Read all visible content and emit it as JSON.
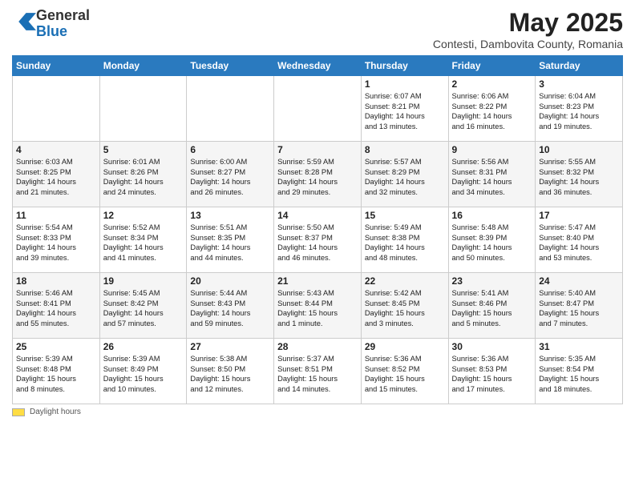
{
  "header": {
    "logo_line1": "General",
    "logo_line2": "Blue",
    "title": "May 2025",
    "subtitle": "Contesti, Dambovita County, Romania"
  },
  "days_of_week": [
    "Sunday",
    "Monday",
    "Tuesday",
    "Wednesday",
    "Thursday",
    "Friday",
    "Saturday"
  ],
  "weeks": [
    [
      {
        "num": "",
        "info": ""
      },
      {
        "num": "",
        "info": ""
      },
      {
        "num": "",
        "info": ""
      },
      {
        "num": "",
        "info": ""
      },
      {
        "num": "1",
        "info": "Sunrise: 6:07 AM\nSunset: 8:21 PM\nDaylight: 14 hours\nand 13 minutes."
      },
      {
        "num": "2",
        "info": "Sunrise: 6:06 AM\nSunset: 8:22 PM\nDaylight: 14 hours\nand 16 minutes."
      },
      {
        "num": "3",
        "info": "Sunrise: 6:04 AM\nSunset: 8:23 PM\nDaylight: 14 hours\nand 19 minutes."
      }
    ],
    [
      {
        "num": "4",
        "info": "Sunrise: 6:03 AM\nSunset: 8:25 PM\nDaylight: 14 hours\nand 21 minutes."
      },
      {
        "num": "5",
        "info": "Sunrise: 6:01 AM\nSunset: 8:26 PM\nDaylight: 14 hours\nand 24 minutes."
      },
      {
        "num": "6",
        "info": "Sunrise: 6:00 AM\nSunset: 8:27 PM\nDaylight: 14 hours\nand 26 minutes."
      },
      {
        "num": "7",
        "info": "Sunrise: 5:59 AM\nSunset: 8:28 PM\nDaylight: 14 hours\nand 29 minutes."
      },
      {
        "num": "8",
        "info": "Sunrise: 5:57 AM\nSunset: 8:29 PM\nDaylight: 14 hours\nand 32 minutes."
      },
      {
        "num": "9",
        "info": "Sunrise: 5:56 AM\nSunset: 8:31 PM\nDaylight: 14 hours\nand 34 minutes."
      },
      {
        "num": "10",
        "info": "Sunrise: 5:55 AM\nSunset: 8:32 PM\nDaylight: 14 hours\nand 36 minutes."
      }
    ],
    [
      {
        "num": "11",
        "info": "Sunrise: 5:54 AM\nSunset: 8:33 PM\nDaylight: 14 hours\nand 39 minutes."
      },
      {
        "num": "12",
        "info": "Sunrise: 5:52 AM\nSunset: 8:34 PM\nDaylight: 14 hours\nand 41 minutes."
      },
      {
        "num": "13",
        "info": "Sunrise: 5:51 AM\nSunset: 8:35 PM\nDaylight: 14 hours\nand 44 minutes."
      },
      {
        "num": "14",
        "info": "Sunrise: 5:50 AM\nSunset: 8:37 PM\nDaylight: 14 hours\nand 46 minutes."
      },
      {
        "num": "15",
        "info": "Sunrise: 5:49 AM\nSunset: 8:38 PM\nDaylight: 14 hours\nand 48 minutes."
      },
      {
        "num": "16",
        "info": "Sunrise: 5:48 AM\nSunset: 8:39 PM\nDaylight: 14 hours\nand 50 minutes."
      },
      {
        "num": "17",
        "info": "Sunrise: 5:47 AM\nSunset: 8:40 PM\nDaylight: 14 hours\nand 53 minutes."
      }
    ],
    [
      {
        "num": "18",
        "info": "Sunrise: 5:46 AM\nSunset: 8:41 PM\nDaylight: 14 hours\nand 55 minutes."
      },
      {
        "num": "19",
        "info": "Sunrise: 5:45 AM\nSunset: 8:42 PM\nDaylight: 14 hours\nand 57 minutes."
      },
      {
        "num": "20",
        "info": "Sunrise: 5:44 AM\nSunset: 8:43 PM\nDaylight: 14 hours\nand 59 minutes."
      },
      {
        "num": "21",
        "info": "Sunrise: 5:43 AM\nSunset: 8:44 PM\nDaylight: 15 hours\nand 1 minute."
      },
      {
        "num": "22",
        "info": "Sunrise: 5:42 AM\nSunset: 8:45 PM\nDaylight: 15 hours\nand 3 minutes."
      },
      {
        "num": "23",
        "info": "Sunrise: 5:41 AM\nSunset: 8:46 PM\nDaylight: 15 hours\nand 5 minutes."
      },
      {
        "num": "24",
        "info": "Sunrise: 5:40 AM\nSunset: 8:47 PM\nDaylight: 15 hours\nand 7 minutes."
      }
    ],
    [
      {
        "num": "25",
        "info": "Sunrise: 5:39 AM\nSunset: 8:48 PM\nDaylight: 15 hours\nand 8 minutes."
      },
      {
        "num": "26",
        "info": "Sunrise: 5:39 AM\nSunset: 8:49 PM\nDaylight: 15 hours\nand 10 minutes."
      },
      {
        "num": "27",
        "info": "Sunrise: 5:38 AM\nSunset: 8:50 PM\nDaylight: 15 hours\nand 12 minutes."
      },
      {
        "num": "28",
        "info": "Sunrise: 5:37 AM\nSunset: 8:51 PM\nDaylight: 15 hours\nand 14 minutes."
      },
      {
        "num": "29",
        "info": "Sunrise: 5:36 AM\nSunset: 8:52 PM\nDaylight: 15 hours\nand 15 minutes."
      },
      {
        "num": "30",
        "info": "Sunrise: 5:36 AM\nSunset: 8:53 PM\nDaylight: 15 hours\nand 17 minutes."
      },
      {
        "num": "31",
        "info": "Sunrise: 5:35 AM\nSunset: 8:54 PM\nDaylight: 15 hours\nand 18 minutes."
      }
    ]
  ],
  "footer": {
    "daylight_label": "Daylight hours"
  }
}
